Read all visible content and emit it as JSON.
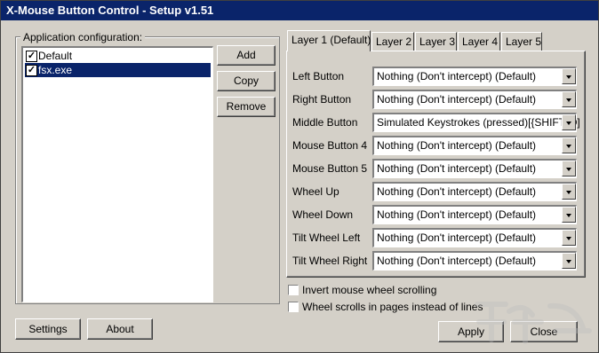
{
  "window": {
    "title": "X-Mouse Button Control - Setup v1.51"
  },
  "app_config": {
    "label": "Application configuration:",
    "items": [
      {
        "label": "Default",
        "checked": true,
        "selected": false
      },
      {
        "label": "fsx.exe",
        "checked": true,
        "selected": true
      }
    ],
    "buttons": {
      "add": "Add",
      "copy": "Copy",
      "remove": "Remove"
    }
  },
  "tabs": [
    {
      "label": "Layer 1 (Default)",
      "active": true
    },
    {
      "label": "Layer 2",
      "active": false
    },
    {
      "label": "Layer 3",
      "active": false
    },
    {
      "label": "Layer 4",
      "active": false
    },
    {
      "label": "Layer 5",
      "active": false
    }
  ],
  "mappings": [
    {
      "label": "Left Button",
      "value": "Nothing (Don't intercept) (Default)"
    },
    {
      "label": "Right Button",
      "value": "Nothing (Don't intercept) (Default)"
    },
    {
      "label": "Middle Button",
      "value": "Simulated Keystrokes (pressed)[{SHIFT}O]"
    },
    {
      "label": "Mouse Button 4",
      "value": "Nothing (Don't intercept) (Default)"
    },
    {
      "label": "Mouse Button 5",
      "value": "Nothing (Don't intercept) (Default)"
    },
    {
      "label": "Wheel Up",
      "value": "Nothing (Don't intercept) (Default)"
    },
    {
      "label": "Wheel Down",
      "value": "Nothing (Don't intercept) (Default)"
    },
    {
      "label": "Tilt Wheel Left",
      "value": "Nothing (Don't intercept) (Default)"
    },
    {
      "label": "Tilt Wheel Right",
      "value": "Nothing (Don't intercept) (Default)"
    }
  ],
  "options": {
    "invert_wheel": {
      "label": "Invert mouse wheel scrolling",
      "checked": false
    },
    "wheel_pages": {
      "label": "Wheel scrolls in pages instead of lines",
      "checked": false
    }
  },
  "footer": {
    "settings": "Settings",
    "about": "About",
    "apply": "Apply",
    "close": "Close"
  },
  "colors": {
    "titlebar": "#0a246a",
    "face": "#d4d0c8",
    "selection": "#0a246a"
  }
}
